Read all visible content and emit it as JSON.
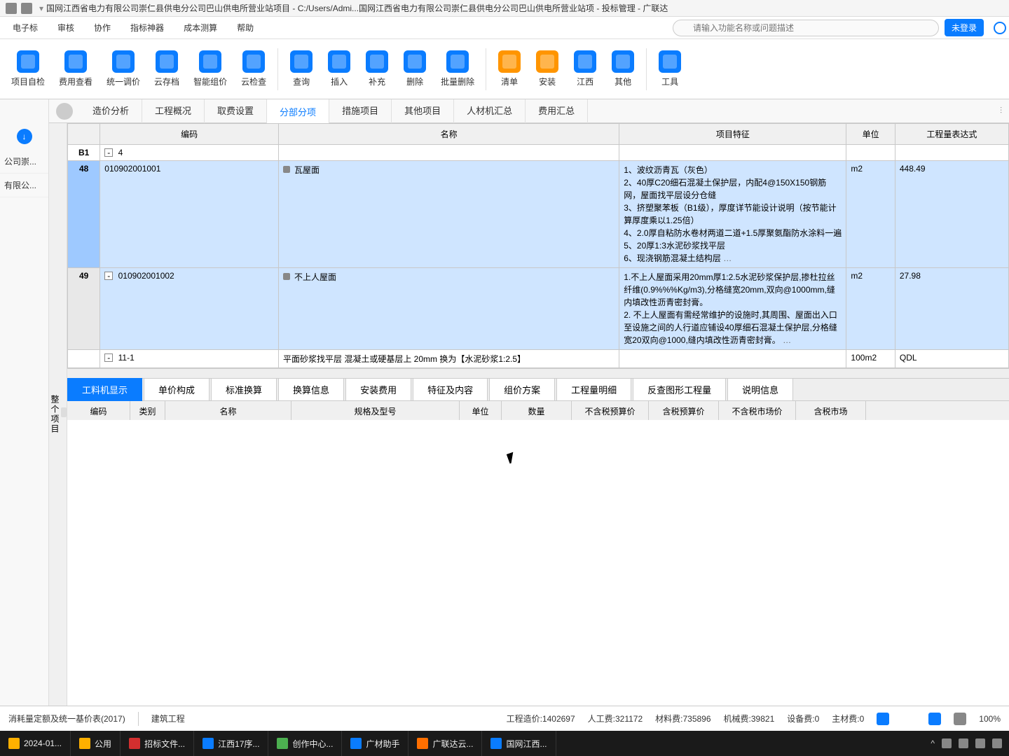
{
  "titlebar": {
    "text": "国网江西省电力有限公司崇仁县供电分公司巴山供电所营业站项目 - C:/Users/Admi...国网江西省电力有限公司崇仁县供电分公司巴山供电所营业站项 - 投标管理 - 广联达"
  },
  "menu": [
    "电子标",
    "审核",
    "协作",
    "指标神器",
    "成本测算",
    "帮助"
  ],
  "search_placeholder": "请输入功能名称或问题描述",
  "login_btn": "未登录",
  "ribbon": [
    {
      "l": "项目自检"
    },
    {
      "l": "费用查看"
    },
    {
      "l": "统一调价"
    },
    {
      "l": "云存档"
    },
    {
      "l": "智能组价"
    },
    {
      "l": "云检查"
    },
    {
      "sep": true
    },
    {
      "l": "查询"
    },
    {
      "l": "插入"
    },
    {
      "l": "补充"
    },
    {
      "l": "删除"
    },
    {
      "l": "批量删除"
    },
    {
      "sep": true
    },
    {
      "l": "清单",
      "o": true
    },
    {
      "l": "安装",
      "o": true
    },
    {
      "l": "江西"
    },
    {
      "l": "其他"
    },
    {
      "sep": true
    },
    {
      "l": "工具"
    }
  ],
  "left_items": [
    "公司崇...",
    "有限公..."
  ],
  "tabs": [
    "造价分析",
    "工程概况",
    "取费设置",
    "分部分项",
    "措施项目",
    "其他项目",
    "人材机汇总",
    "费用汇总"
  ],
  "active_tab": 3,
  "vtab": "整个项目",
  "grid_headers": [
    "",
    "编码",
    "名称",
    "项目特征",
    "单位",
    "工程量表达式"
  ],
  "rows": [
    {
      "num": "B1",
      "code": "4",
      "toggle": "-",
      "name": "",
      "feat": "",
      "unit": "",
      "qty": "",
      "norm": true
    },
    {
      "num": "48",
      "code": "010902001001",
      "name": "瓦屋面",
      "lock": true,
      "feat": "1、波纹沥青瓦（灰色）\n2、40厚C20细石混凝土保护层，内配4@150X150钢筋网，屋面找平层设分仓缝\n3、挤塑聚苯板（B1级），厚度详节能设计说明（按节能计算厚度乘以1.25倍）\n4、2.0厚自粘防水卷材两道二道+1.5厚聚氨酯防水涂料一遍\n5、20厚1:3水泥砂浆找平层\n6、现浇钢筋混凝土结构层",
      "unit": "m2",
      "qty": "448.49",
      "sel": true
    },
    {
      "num": "49",
      "code": "010902001002",
      "name": "不上人屋面",
      "lock": true,
      "feat": "1.不上人屋面采用20mm厚1:2.5水泥砂浆保护层,掺杜拉丝纤维(0.9%%%Kg/m3),分格缝宽20mm,双向@1000mm,缝内填改性沥青密封膏。\n2. 不上人屋面有需经常维护的设施时,其周围、屋面出入口至设施之间的人行道应铺设40厚细石混凝土保护层,分格缝宽20双向@1000,缝内填改性沥青密封膏。",
      "unit": "m2",
      "qty": "27.98"
    },
    {
      "num": "",
      "code": "11-1",
      "name": "平面砂浆找平层 混凝土或硬基层上 20mm   换为【水泥砂浆1:2.5】",
      "feat": "",
      "unit": "100m2",
      "qty": "QDL",
      "norm": true
    }
  ],
  "bottom_tabs": [
    "工料机显示",
    "单价构成",
    "标准换算",
    "换算信息",
    "安装费用",
    "特征及内容",
    "组价方案",
    "工程量明细",
    "反查图形工程量",
    "说明信息"
  ],
  "active_btab": 0,
  "sub_headers": [
    "编码",
    "类别",
    "名称",
    "规格及型号",
    "单位",
    "数量",
    "不含税预算价",
    "含税预算价",
    "不含税市场价",
    "含税市场"
  ],
  "status": {
    "left": "消耗量定额及统一基价表(2017)",
    "mid": "建筑工程",
    "cost": "工程造价:1402697",
    "labor": "人工费:321172",
    "mat": "材料费:735896",
    "mach": "机械费:39821",
    "equip": "设备费:0",
    "main": "主材费:0",
    "zoom": "100%"
  },
  "taskbar": [
    {
      "l": "2024-01...",
      "c": ""
    },
    {
      "l": "公用",
      "c": ""
    },
    {
      "l": "招标文件...",
      "c": "r"
    },
    {
      "l": "江西17序...",
      "c": "b"
    },
    {
      "l": "创作中心...",
      "c": "g"
    },
    {
      "l": "广材助手",
      "c": "b"
    },
    {
      "l": "广联达云...",
      "c": "o"
    },
    {
      "l": "国网江西...",
      "c": "b"
    }
  ]
}
